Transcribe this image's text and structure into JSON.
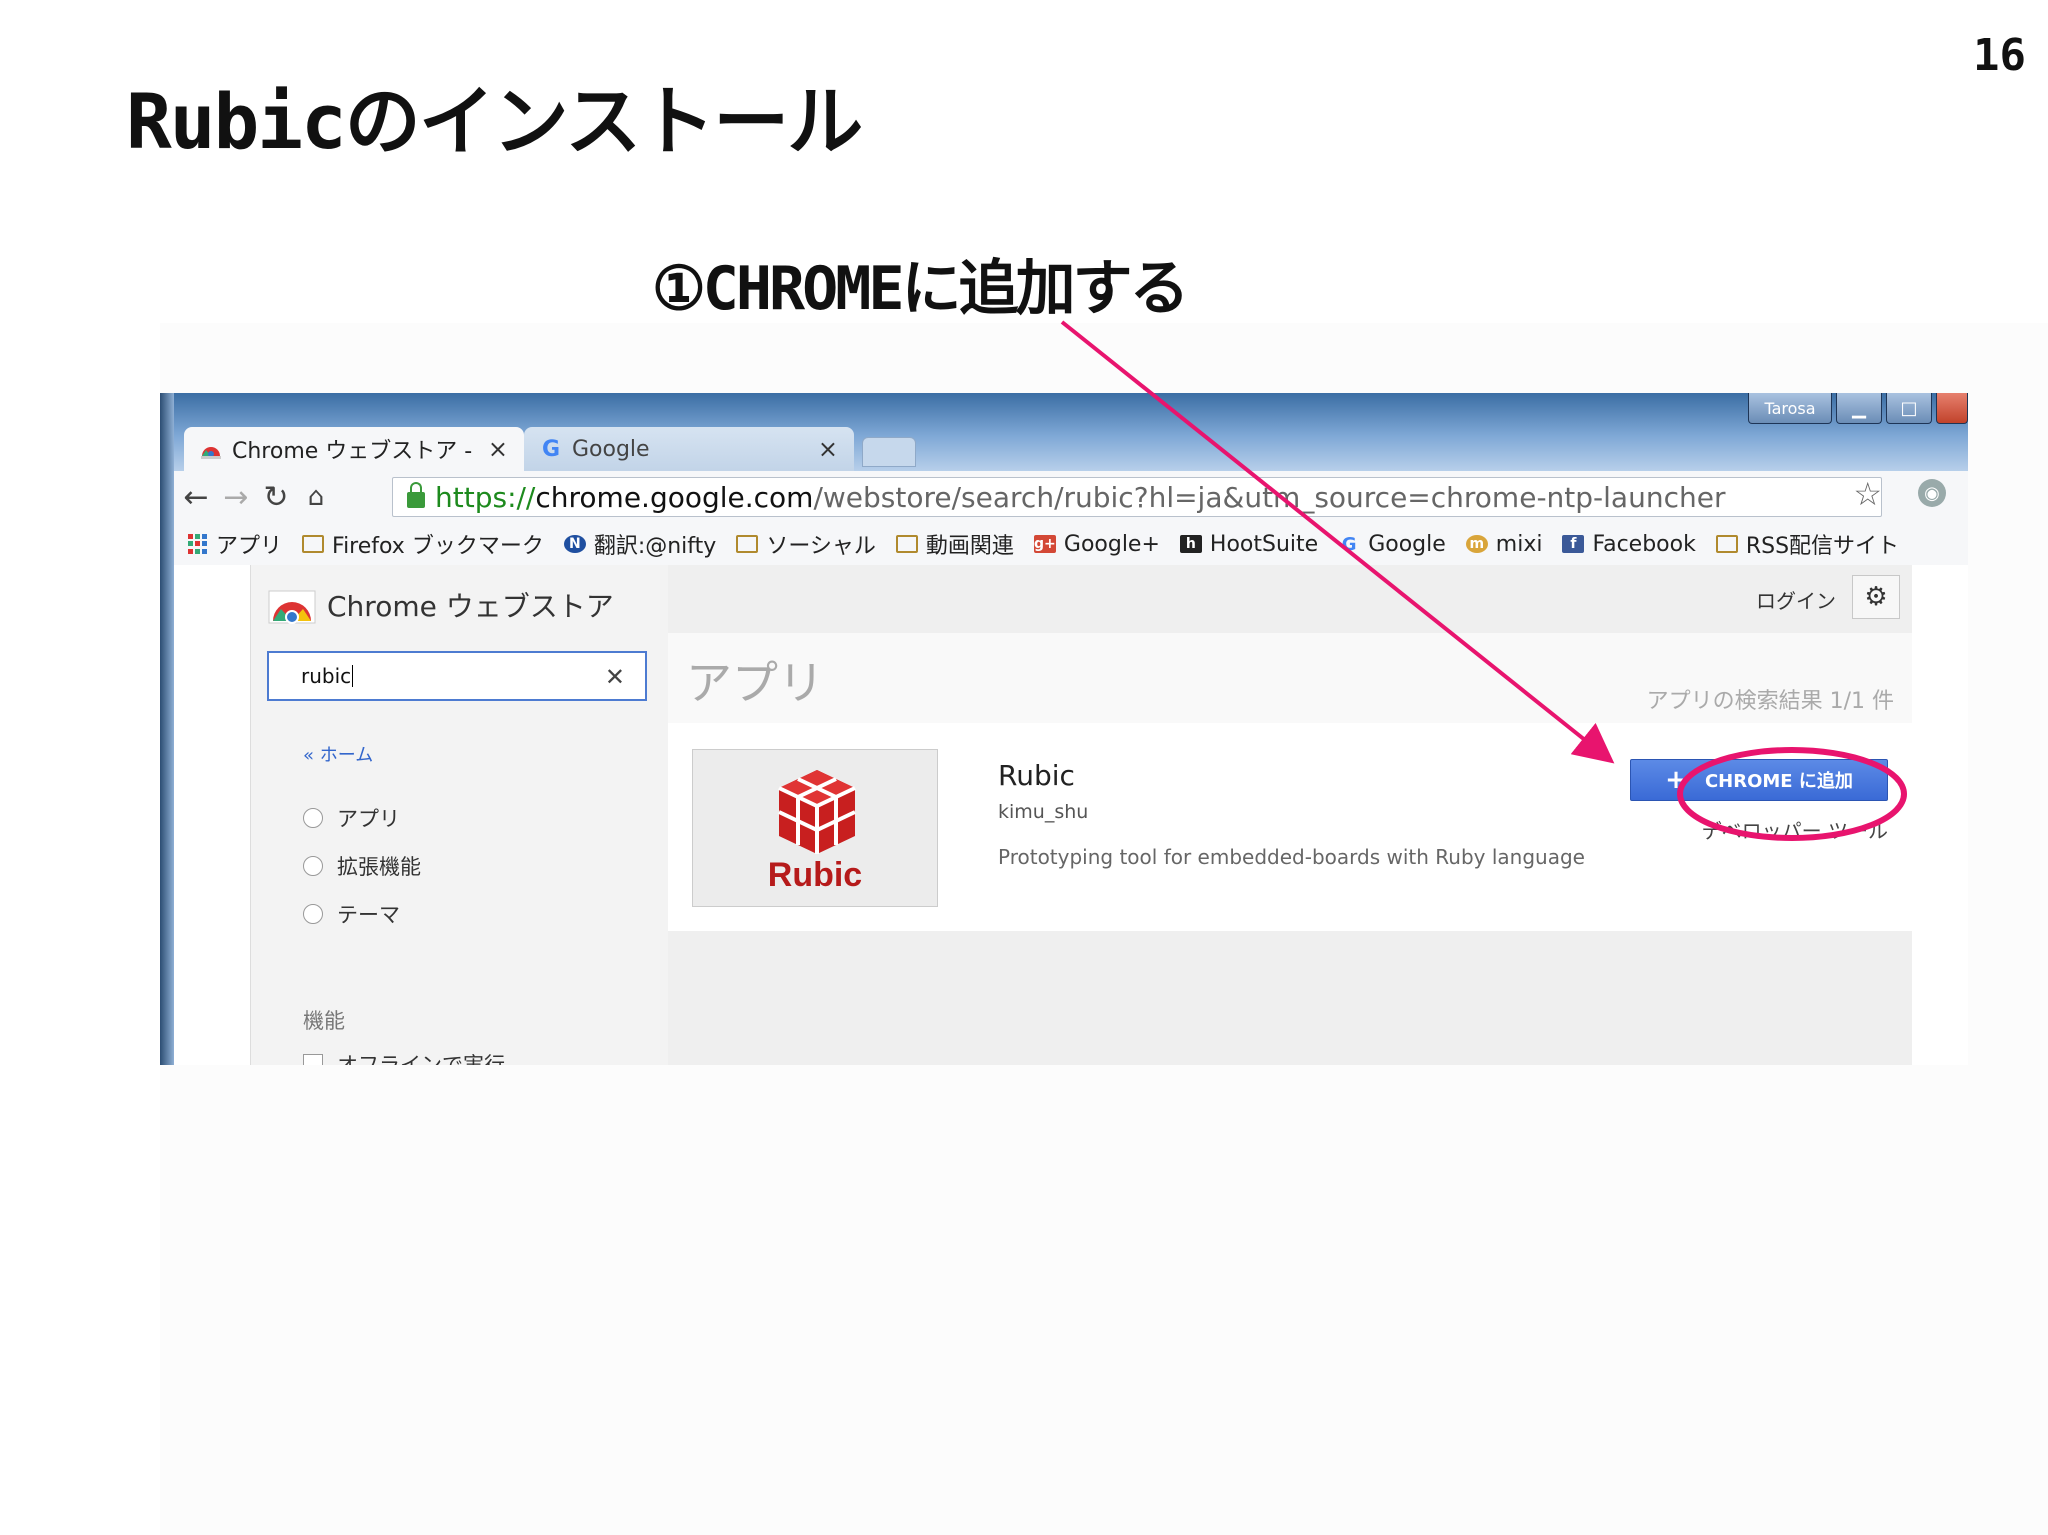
{
  "slide": {
    "page_number": "16",
    "title": "Rubicのインストール",
    "annotation": "①CHROMEに追加する"
  },
  "colors": {
    "highlight": "#e8146e",
    "button_blue": "#3a6ad6"
  },
  "browser": {
    "window_controls": {
      "user": "Tarosa",
      "minimize": "▁",
      "maximize": "□"
    },
    "tabs": [
      {
        "label": "Chrome ウェブストア - ",
        "close": "×",
        "icon": "chrome-store-icon"
      },
      {
        "label": "Google",
        "close": "×",
        "icon": "google-icon"
      }
    ],
    "address": {
      "scheme": "https://",
      "host": "chrome.google.com",
      "rest": "/webstore/search/rubic?hl=ja&utm_source=chrome-ntp-launcher"
    },
    "bookmarks": [
      {
        "label": "アプリ",
        "icon": "apps-grid-icon"
      },
      {
        "label": "Firefox ブックマーク",
        "icon": "folder-icon"
      },
      {
        "label": "翻訳:@nifty",
        "icon": "nifty-icon"
      },
      {
        "label": "ソーシャル",
        "icon": "folder-icon"
      },
      {
        "label": "動画関連",
        "icon": "folder-icon"
      },
      {
        "label": "Google+",
        "icon": "google-plus-icon"
      },
      {
        "label": "HootSuite",
        "icon": "hootsuite-icon"
      },
      {
        "label": "Google",
        "icon": "google-icon"
      },
      {
        "label": "mixi",
        "icon": "mixi-icon"
      },
      {
        "label": "Facebook",
        "icon": "facebook-icon"
      },
      {
        "label": "RSS配信サイト",
        "icon": "folder-icon"
      }
    ]
  },
  "store": {
    "title": "Chrome ウェブストア",
    "search_value": "rubic",
    "home_link": "« ホーム",
    "filters": [
      "アプリ",
      "拡張機能",
      "テーマ"
    ],
    "features_heading": "機能",
    "feature_item": "オフラインで実行",
    "login": "ログイン",
    "section_title": "アプリ",
    "result_count": "アプリの検索結果 1/1 件",
    "result": {
      "thumb_label": "Rubic",
      "name": "Rubic",
      "author": "kimu_shu",
      "description": "Prototyping tool for embedded-boards with Ruby language",
      "add_button": "CHROME に追加",
      "dev_tools": "デベロッパー ツール"
    }
  }
}
